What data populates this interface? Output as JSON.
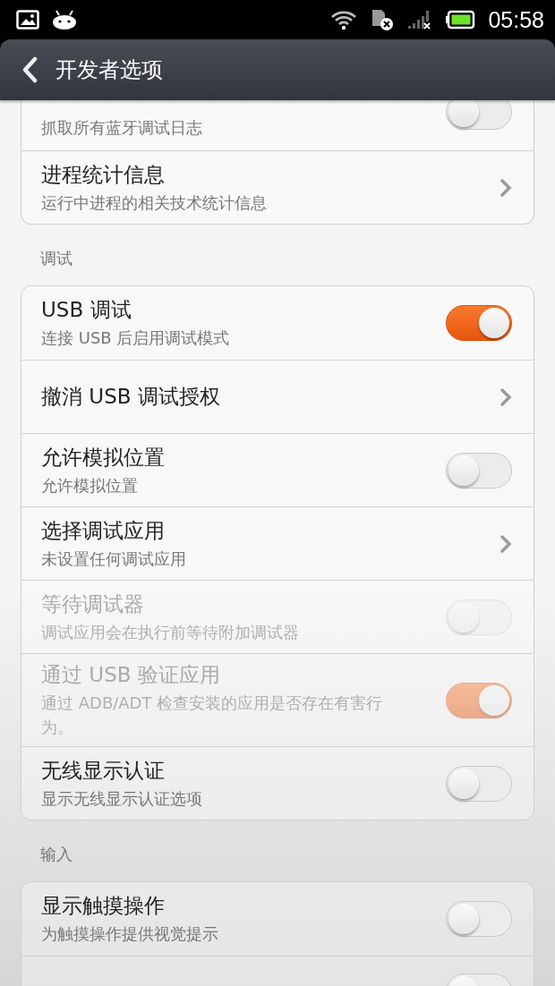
{
  "status_bar": {
    "time": "05:58"
  },
  "header": {
    "title": "开发者选项"
  },
  "sections": [
    {
      "items": [
        {
          "kind": "toggle",
          "subtitle": "抓取所有蓝牙调试日志",
          "on": false,
          "disabled": false
        },
        {
          "kind": "link",
          "title": "进程统计信息",
          "subtitle": "运行中进程的相关技术统计信息",
          "disabled": false
        }
      ]
    },
    {
      "heading": "调试",
      "items": [
        {
          "kind": "toggle",
          "title": "USB 调试",
          "subtitle": "连接 USB 后启用调试模式",
          "on": true,
          "disabled": false
        },
        {
          "kind": "link",
          "title": "撤消 USB 调试授权",
          "disabled": false
        },
        {
          "kind": "toggle",
          "title": "允许模拟位置",
          "subtitle": "允许模拟位置",
          "on": false,
          "disabled": false
        },
        {
          "kind": "link",
          "title": "选择调试应用",
          "subtitle": "未设置任何调试应用",
          "disabled": false
        },
        {
          "kind": "toggle",
          "title": "等待调试器",
          "subtitle": "调试应用会在执行前等待附加调试器",
          "on": false,
          "disabled": true
        },
        {
          "kind": "toggle",
          "title": "通过 USB 验证应用",
          "subtitle": "通过 ADB/ADT 检查安装的应用是否存在有害行为。",
          "on": true,
          "disabled": true
        },
        {
          "kind": "toggle",
          "title": "无线显示认证",
          "subtitle": "显示无线显示认证选项",
          "on": false,
          "disabled": false
        }
      ]
    },
    {
      "heading": "输入",
      "items": [
        {
          "kind": "toggle",
          "title": "显示触摸操作",
          "subtitle": "为触摸操作提供视觉提示",
          "on": false,
          "disabled": false
        },
        {
          "kind": "toggle",
          "on": false,
          "disabled": false
        }
      ]
    }
  ]
}
